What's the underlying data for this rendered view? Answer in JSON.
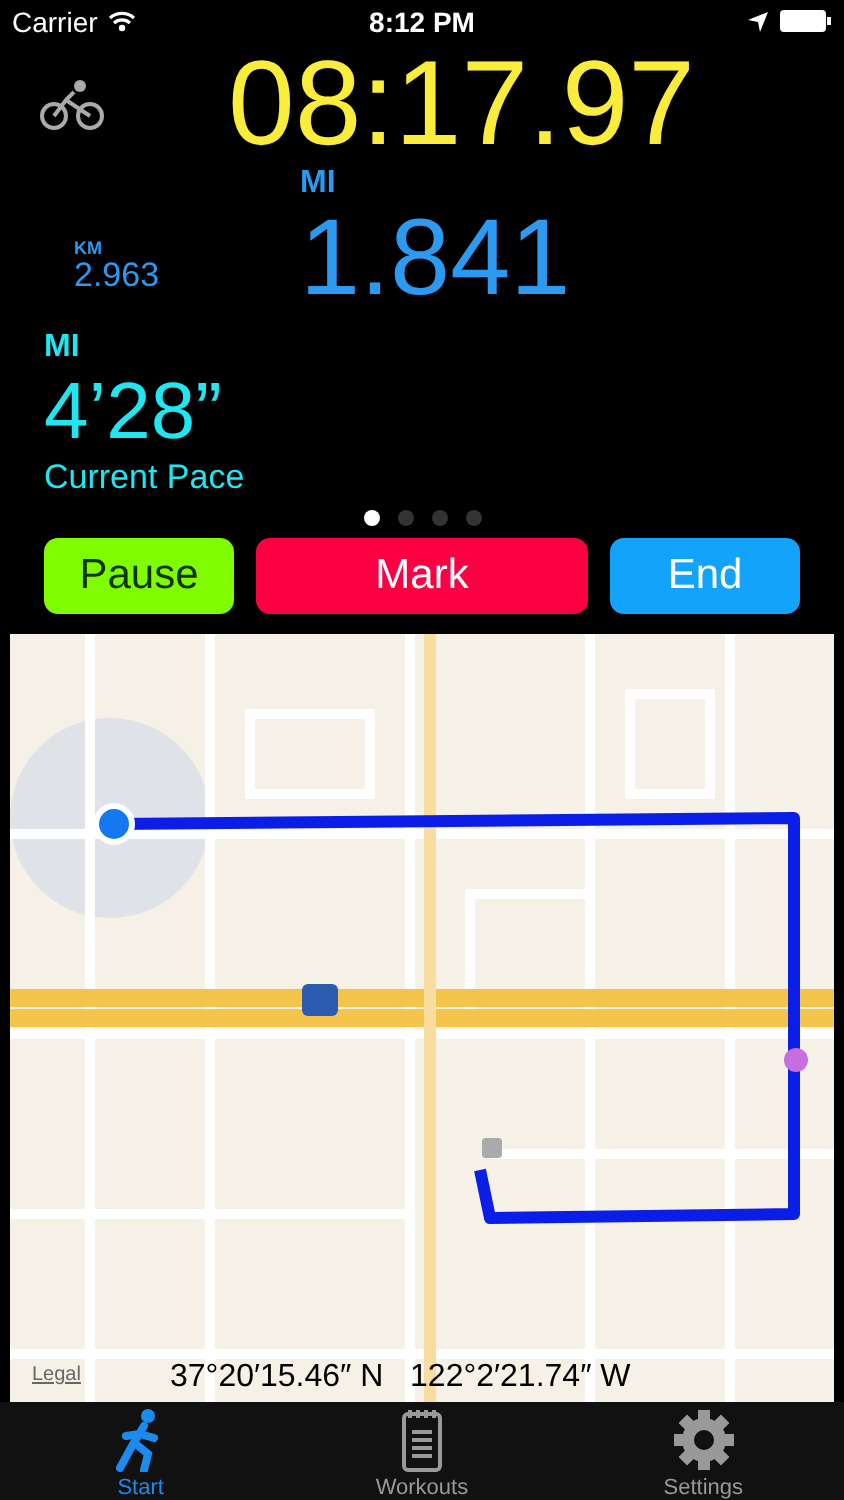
{
  "status_bar": {
    "carrier": "Carrier",
    "time": "8:12 PM"
  },
  "timer": "08:17.97",
  "distance_secondary": {
    "unit": "KM",
    "value": "2.963"
  },
  "distance_primary": {
    "unit": "MI",
    "value": "1.841"
  },
  "pace": {
    "unit": "MI",
    "value": "4’28”",
    "label": "Current Pace"
  },
  "pages": [
    {
      "selected": true
    },
    {
      "selected": false
    },
    {
      "selected": false
    },
    {
      "selected": false
    }
  ],
  "buttons": [
    {
      "label": "Pause",
      "kind": "pause"
    },
    {
      "label": "Mark",
      "kind": "mark"
    },
    {
      "label": "End",
      "kind": "end"
    }
  ],
  "map": {
    "legal": "Legal",
    "coordinates": "37°20′15.46″ N   122°2′21.74″ W"
  },
  "tabs": [
    {
      "label": "Start",
      "kind": "start",
      "selected": true
    },
    {
      "label": "Workouts",
      "kind": "workouts",
      "selected": false
    },
    {
      "label": "Settings",
      "kind": "settings",
      "selected": false
    }
  ]
}
